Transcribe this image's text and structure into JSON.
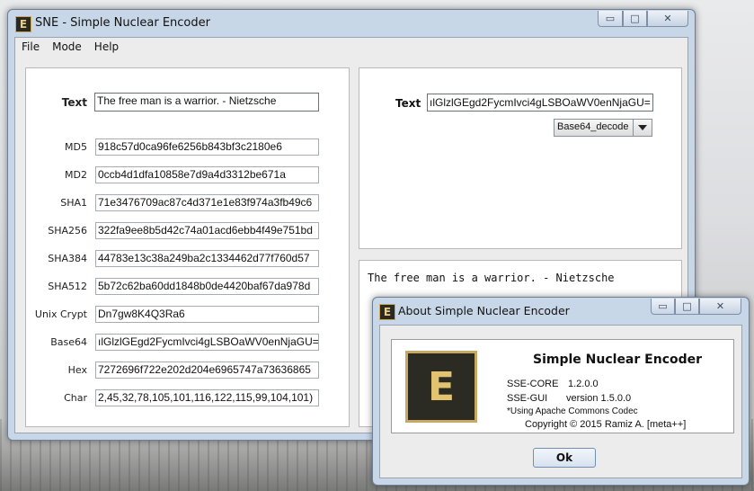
{
  "main_window": {
    "title": "SNE - Simple Nuclear Encoder",
    "icon_letter": "E",
    "controls": {
      "minimize": "▭",
      "maximize": "□",
      "close": "✕"
    }
  },
  "menu": [
    "File",
    "Mode",
    "Help"
  ],
  "encoder": {
    "text_label": "Text",
    "text_value": "The free man is a warrior. - Nietzsche",
    "rows": [
      {
        "label": "MD5",
        "value": "918c57d0ca96fe6256b843bf3c2180e6"
      },
      {
        "label": "MD2",
        "value": "0ccb4d1dfa10858e7d9a4d3312be671a"
      },
      {
        "label": "SHA1",
        "value": "71e3476709ac87c4d371e1e83f974a3fb49c6"
      },
      {
        "label": "SHA256",
        "value": "322fa9ee8b5d42c74a01acd6ebb4f49e751bd"
      },
      {
        "label": "SHA384",
        "value": "44783e13c38a249ba2c1334462d77f760d57"
      },
      {
        "label": "SHA512",
        "value": "5b72c62ba60dd1848b0de4420baf67da978d"
      },
      {
        "label": "Unix Crypt",
        "value": "Dn7gw8K4Q3Ra6"
      },
      {
        "label": "Base64",
        "value": "ılGlzlGEgd2FycmIvci4gLSBOaWV0enNjaGU="
      },
      {
        "label": "Hex",
        "value": "7272696f722e202d204e6965747a73636865"
      },
      {
        "label": "Char",
        "value": "2,45,32,78,105,101,116,122,115,99,104,101)"
      }
    ]
  },
  "decoder": {
    "text_label": "Text",
    "text_value": "ılGlzlGEgd2FycmIvci4gLSBOaWV0enNjaGU=",
    "mode_selected": "Base64_decode",
    "output": "The free man is a warrior. - Nietzsche"
  },
  "about": {
    "title": "About Simple Nuclear Encoder",
    "icon_letter": "E",
    "app_name": "Simple Nuclear Encoder",
    "core_label": "SSE-CORE",
    "core_version": "1.2.0.0",
    "gui_label": "SSE-GUI",
    "gui_version": "version 1.5.0.0",
    "note": "*Using Apache Commons Codec",
    "copyright": "Copyright © 2015  Ramiz A. [meta++]",
    "ok_label": "Ok",
    "controls": {
      "minimize": "▭",
      "maximize": "□",
      "close": "✕"
    }
  }
}
